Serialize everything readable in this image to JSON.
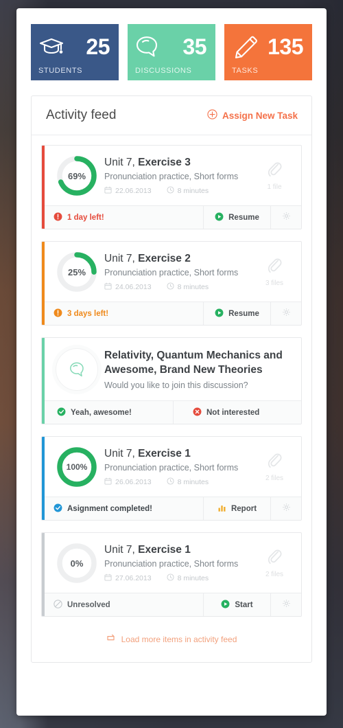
{
  "theme": {
    "navy": "#3a5888",
    "mint": "#6ad1a8",
    "orange": "#f4743b",
    "green": "#27b161",
    "red": "#e54b3c",
    "amber": "#ef8a1c",
    "blue": "#2196d6",
    "gray": "#9aa0a6",
    "link_orange": "#f4714a",
    "panel_bg": "#ffffff"
  },
  "stats": [
    {
      "value": "25",
      "label": "STUDENTS",
      "icon": "graduation-cap-icon",
      "color": "#3a5888"
    },
    {
      "value": "35",
      "label": "DISCUSSIONS",
      "icon": "speech-bubble-icon",
      "color": "#6ad1a8"
    },
    {
      "value": "135",
      "label": "TASKS",
      "icon": "pencil-icon",
      "color": "#f4743b"
    }
  ],
  "feed": {
    "title": "Activity feed",
    "assign_label": "Assign New Task",
    "assign_icon": "plus-circle-icon",
    "load_more_label": "Load more items in activity feed",
    "load_more_icon": "refresh-icon",
    "items": [
      {
        "type": "task",
        "accent": "#e54b3c",
        "progress": 69,
        "progress_label": "69%",
        "title_prefix": "Unit 7, ",
        "title_bold": "Exercise 3",
        "subtitle": "Pronunciation practice, Short forms",
        "date": "22.06.2013",
        "date_icon": "calendar-icon",
        "duration": "8 minutes",
        "duration_icon": "clock-icon",
        "attachment_label": "1 file",
        "attachment_icon": "paperclip-icon",
        "status_text": "1 day left!",
        "status_icon": "exclamation-circle-icon",
        "status_color": "#e54b3c",
        "action_label": "Resume",
        "action_icon": "play-circle-icon",
        "gear_icon": "gear-icon"
      },
      {
        "type": "task",
        "accent": "#ef8a1c",
        "progress": 25,
        "progress_label": "25%",
        "title_prefix": "Unit 7, ",
        "title_bold": "Exercise 2",
        "subtitle": "Pronunciation practice, Short forms",
        "date": "24.06.2013",
        "date_icon": "calendar-icon",
        "duration": "8 minutes",
        "duration_icon": "clock-icon",
        "attachment_label": "3 files",
        "attachment_icon": "paperclip-icon",
        "status_text": "3 days left!",
        "status_icon": "exclamation-circle-icon",
        "status_color": "#ef8a1c",
        "action_label": "Resume",
        "action_icon": "play-circle-icon",
        "gear_icon": "gear-icon"
      },
      {
        "type": "discussion",
        "accent": "#6ad1a8",
        "icon": "speech-bubble-outline-icon",
        "title": "Relativity, Quantum Mechanics and Awesome, Brand New Theories",
        "subtitle": "Would you like to join this discussion?",
        "accept_label": "Yeah, awesome!",
        "accept_icon": "check-circle-icon",
        "decline_label": "Not interested",
        "decline_icon": "x-circle-icon"
      },
      {
        "type": "task",
        "accent": "#2196d6",
        "progress": 100,
        "progress_label": "100%",
        "title_prefix": "Unit 7, ",
        "title_bold": "Exercise 1",
        "subtitle": "Pronunciation practice, Short forms",
        "date": "26.06.2013",
        "date_icon": "calendar-icon",
        "duration": "8 minutes",
        "duration_icon": "clock-icon",
        "attachment_label": "2 files",
        "attachment_icon": "paperclip-icon",
        "status_text": "Asignment completed!",
        "status_icon": "check-circle-icon",
        "status_color": "#2196d6",
        "action_label": "Report",
        "action_icon": "bar-chart-icon",
        "gear_icon": "gear-icon"
      },
      {
        "type": "task",
        "accent": "#c8ccd0",
        "progress": 0,
        "progress_label": "0%",
        "title_prefix": "Unit 7, ",
        "title_bold": "Exercise 1",
        "subtitle": "Pronunciation practice, Short forms",
        "date": "27.06.2013",
        "date_icon": "calendar-icon",
        "duration": "8 minutes",
        "duration_icon": "clock-icon",
        "attachment_label": "2 files",
        "attachment_icon": "paperclip-icon",
        "status_text": "Unresolved",
        "status_icon": "ban-circle-icon",
        "status_color": "#9aa0a6",
        "action_label": "Start",
        "action_icon": "play-circle-icon",
        "gear_icon": "gear-icon"
      }
    ]
  }
}
